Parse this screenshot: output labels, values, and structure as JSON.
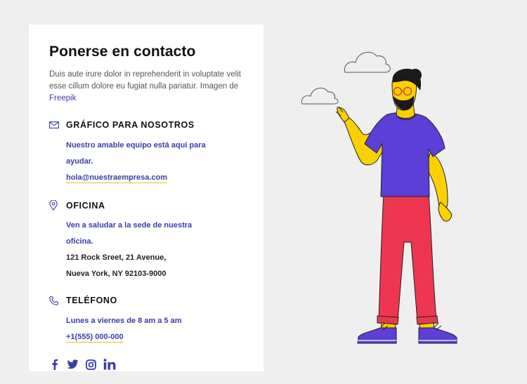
{
  "contact": {
    "title": "Ponerse en contacto",
    "intro": "Duis aute irure dolor in reprehenderit in voluptate velit esse cillum dolore eu fugiat nulla pariatur. Imagen de",
    "credit": "Freepik"
  },
  "graphic": {
    "heading": "GRÁFICO PARA NOSOTROS",
    "line1": "Nuestro amable equipo está aquí para",
    "line2": "ayudar.",
    "email": "hola@nuestraempresa.com"
  },
  "office": {
    "heading": "OFICINA",
    "line1": "Ven a saludar a la sede de nuestra",
    "line2": "oficina.",
    "address1": "121 Rock Sreet, 21 Avenue,",
    "address2": "Nueva York, NY 92103-9000"
  },
  "phone": {
    "heading": "TELÉFONO",
    "hours": "Lunes a viernes de 8 am a 5 am",
    "number": "+1(555) 000-000"
  },
  "social_icons": [
    "facebook-icon",
    "twitter-icon",
    "instagram-icon",
    "linkedin-icon"
  ],
  "colors": {
    "accent": "#3a3ca8",
    "underline": "#d8c81e",
    "shirt": "#5b3fd6",
    "pants": "#ee3650",
    "skin": "#fbd000"
  }
}
